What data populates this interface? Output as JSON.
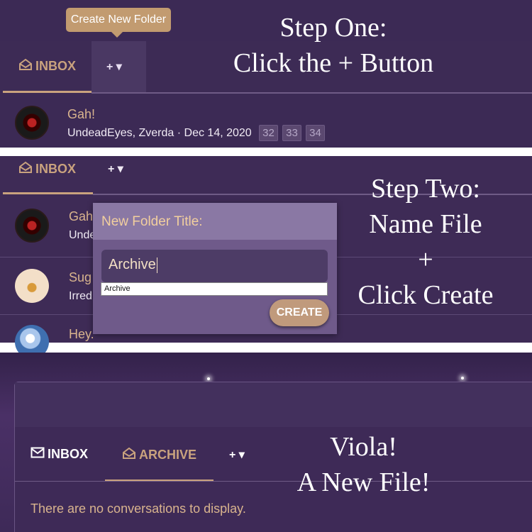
{
  "step1": {
    "caption_line1": "Step One:",
    "caption_line2": "Click the + Button",
    "tooltip": "Create New Folder",
    "tabs": {
      "inbox": "INBOX",
      "plus": "+ ▾"
    },
    "conversation": {
      "title": "Gah!",
      "meta": "UndeadEyes, Zverda · Dec 14, 2020",
      "pages": [
        "32",
        "33",
        "34"
      ]
    }
  },
  "step2": {
    "caption_line1": "Step Two:",
    "caption_line2": "Name File",
    "caption_line3": "+",
    "caption_line4": "Click Create",
    "tabs": {
      "inbox": "INBOX",
      "plus": "+ ▾"
    },
    "rows": [
      {
        "title": "Gah",
        "meta": "Unde"
      },
      {
        "title": "Sug",
        "meta": "Irred"
      },
      {
        "title": "Hey."
      }
    ],
    "dialog": {
      "title": "New Folder Title:",
      "input_value": "Archive",
      "autocomplete": "Archive",
      "button": "CREATE"
    }
  },
  "step3": {
    "caption_line1": "Viola!",
    "caption_line2": "A New File!",
    "tabs": {
      "inbox": "INBOX",
      "archive": "ARCHIVE",
      "plus": "+ ▾"
    },
    "empty_message": "There are no conversations to display."
  },
  "colors": {
    "background": "#3c2a55",
    "accent": "#c9a27e",
    "tooltip": "#c29b70",
    "link_text": "#d9b48e"
  },
  "icons": {
    "inbox_open": "envelope-open-icon",
    "inbox_closed": "envelope-icon",
    "caret": "chevron-down-icon"
  }
}
